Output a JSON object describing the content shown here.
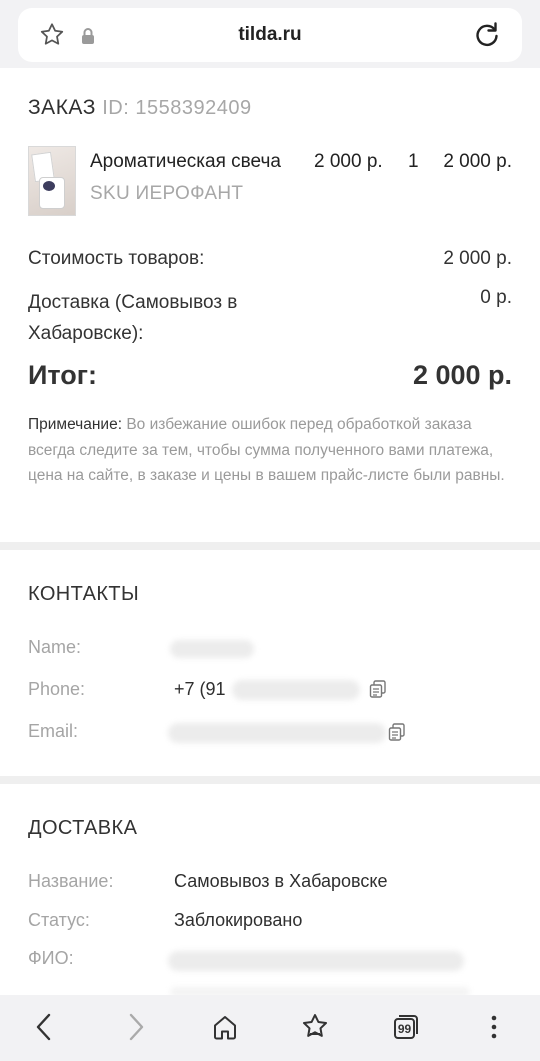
{
  "browser": {
    "host": "tilda.ru",
    "icons": [
      "star-icon",
      "lock-icon",
      "reload-icon"
    ]
  },
  "order": {
    "label": "ЗАКАЗ",
    "id_text": "ID: 1558392409",
    "item": {
      "name": "Ароматическая свеча",
      "sku": "SKU ИЕРОФАНТ",
      "price": "2 000 р.",
      "qty": "1",
      "total": "2 000 р."
    },
    "subtotal_label": "Стоимость товаров:",
    "subtotal_value": "2 000 р.",
    "delivery_label": "Доставка (Самовывоз в Хабаровске):",
    "delivery_value": "0 р.",
    "grand_label": "Итог:",
    "grand_value": "2 000 р.",
    "note_label": "Примечание:",
    "note_text": "Во избежание ошибок перед обработкой заказа всегда следите за тем, чтобы сумма полученного вами платежа, цена на сайте, в заказе и цены в вашем прайс-листе были равны."
  },
  "contacts": {
    "title": "КОНТАКТЫ",
    "name_label": "Name:",
    "phone_label": "Phone:",
    "phone_partial": "+7 (91",
    "email_label": "Email:"
  },
  "delivery": {
    "title": "ДОСТАВКА",
    "name_label": "Название:",
    "name_value": "Самовывоз в Хабаровске",
    "status_label": "Статус:",
    "status_value": "Заблокировано",
    "fio_label": "ФИО:"
  },
  "bottom_nav": {
    "tabs_count": "99",
    "icons": [
      "back-icon",
      "forward-icon",
      "home-icon",
      "bookmarks-icon",
      "tabs-icon",
      "menu-icon"
    ]
  },
  "colors": {
    "bar_bg": "#f2f2f4",
    "muted_text": "#a7a7a7",
    "divider": "#efefef"
  }
}
